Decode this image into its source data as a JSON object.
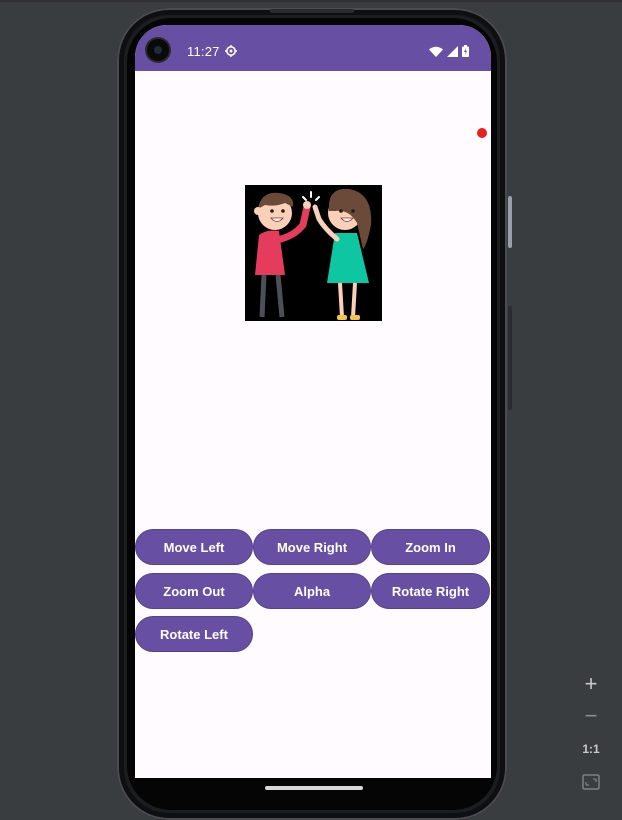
{
  "status_bar": {
    "time": "11:27",
    "icons": [
      "settings-icon",
      "wifi-icon",
      "signal-icon",
      "battery-icon"
    ],
    "color": "#6750a4"
  },
  "app": {
    "image": "high-five-illustration",
    "buttons": {
      "move_left": "Move Left",
      "move_right": "Move Right",
      "zoom_in": "Zoom In",
      "zoom_out": "Zoom Out",
      "alpha": "Alpha",
      "rotate_right": "Rotate Right",
      "rotate_left": "Rotate Left"
    },
    "button_color": "#6750a4"
  },
  "emulator_controls": {
    "plus": "+",
    "minus": "−",
    "one_to_one": "1:1",
    "icons": [
      "zoom-in-icon",
      "zoom-out-icon",
      "fit-screen-icon"
    ]
  }
}
